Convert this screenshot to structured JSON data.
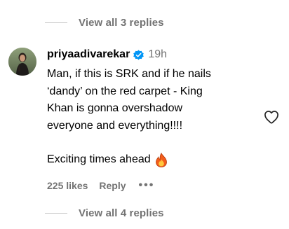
{
  "replies_top": {
    "label": "View all 3 replies"
  },
  "comment": {
    "username": "priyaadivarekar",
    "time": "19h",
    "lines_p1": "Man, if this is SRK and if he nails\n‘dandy’ on the red carpet - King\nKhan is gonna overshadow\neveryone and everything!!!!",
    "line_p2": "Exciting times ahead",
    "likes": "225 likes",
    "reply_label": "Reply",
    "more_label": "•••"
  },
  "replies_bottom": {
    "label": "View all 4 replies"
  },
  "icons": {
    "verified": "verified-badge-icon",
    "fire": "fire-emoji-icon",
    "heart": "heart-outline-icon"
  },
  "colors": {
    "secondary_text": "#737373",
    "verified_blue": "#0095f6",
    "divider": "#c7c7c7"
  }
}
